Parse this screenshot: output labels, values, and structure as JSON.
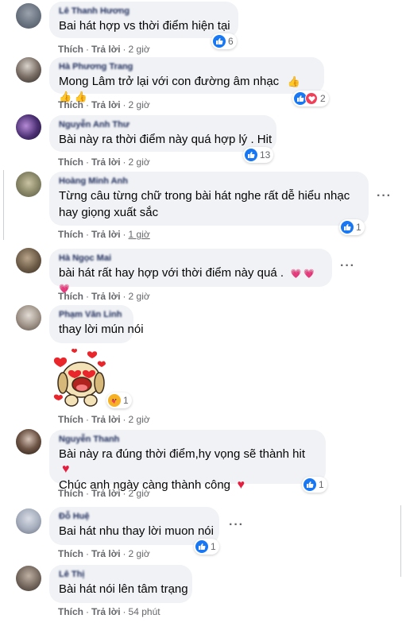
{
  "actions": {
    "like": "Thích",
    "reply": "Trả lời",
    "sep": "·"
  },
  "comments": [
    {
      "author": "Lê Thanh Hương",
      "text": "Bai hát hợp vs thời điểm hiện tại",
      "time": "2 giờ",
      "reactions": "6"
    },
    {
      "author": "Hà Phương Trang",
      "text": "Mong Lâm trở lại với con đường âm nhạc",
      "emoji": "👍 👍 👍",
      "time": "2 giờ",
      "reactions": "2"
    },
    {
      "author": "Nguyễn Anh Thư",
      "text": "Bài này ra thời điểm này quá hợp lý . Hit",
      "time": "2 giờ",
      "reactions": "13"
    },
    {
      "author": "Hoàng Minh Anh",
      "text_line1": "Từng câu từng chữ trong bài hát nghe rất dễ hiểu nhạc",
      "text_line2": "hay giọng xuất sắc",
      "time": "1 giờ",
      "reactions": "1"
    },
    {
      "author": "Hà Ngọc Mai",
      "text": "bài hát rất hay hợp với thời điểm này quá .",
      "emoji": "💗 💗 💗",
      "time": "2 giờ"
    },
    {
      "author": "Phạm Văn Linh",
      "text": "thay lời mún nói",
      "time": "2 giờ",
      "reactions": "1"
    },
    {
      "author": "Nguyễn Thanh",
      "text_line1": "Bài này ra đúng thời điểm,hy vọng sẽ thành hit",
      "text_line2": "Chúc anh ngày càng thành công",
      "heart": "♥",
      "time": "2 giờ",
      "reactions": "1"
    },
    {
      "author": "Đỗ Huệ",
      "text": "Bai hát nhu thay lời muon nói",
      "time": "2 giờ",
      "reactions": "1"
    },
    {
      "author": "Lê Thị",
      "text": "Bài hát nói lên tâm trạng",
      "time": "54 phút"
    }
  ],
  "icons": {
    "like": "like-icon",
    "love": "love-icon",
    "care": "care-icon",
    "more": "more-options-icon"
  },
  "colors": {
    "bubble": "#f0f2f5",
    "meta": "#65676b",
    "like": "#1877f2",
    "love": "#f33e58",
    "heart": "#e41e3f"
  }
}
